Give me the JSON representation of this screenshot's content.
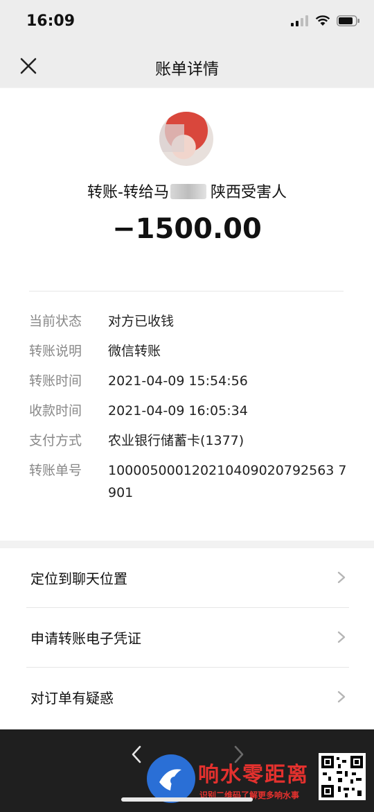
{
  "status": {
    "time": "16:09"
  },
  "nav": {
    "title": "账单详情"
  },
  "bill": {
    "payee_prefix": "转账-转给马",
    "payee_suffix": "陕西受害人",
    "amount": "−1500.00"
  },
  "details": [
    {
      "label": "当前状态",
      "value": "对方已收钱"
    },
    {
      "label": "转账说明",
      "value": "微信转账"
    },
    {
      "label": "转账时间",
      "value": "2021-04-09 15:54:56"
    },
    {
      "label": "收款时间",
      "value": "2021-04-09 16:05:34"
    },
    {
      "label": "支付方式",
      "value": "农业银行储蓄卡(1377)"
    },
    {
      "label": "转账单号",
      "value": "100005000120210409020792563 7901"
    }
  ],
  "menu": [
    {
      "label": "定位到聊天位置"
    },
    {
      "label": "申请转账电子凭证"
    },
    {
      "label": "对订单有疑惑"
    }
  ],
  "watermark": {
    "name": "响水零距离",
    "subtitle": "识别二维码了解更多响水事"
  },
  "colors": {
    "watermark_red": "#e4312e",
    "watermark_blue": "#2a6fd6"
  },
  "icons": [
    "close-icon",
    "chevron-right-icon",
    "signal-icon",
    "wifi-icon",
    "battery-icon",
    "back-arrow-icon",
    "forward-arrow-icon",
    "qr-code-icon"
  ]
}
